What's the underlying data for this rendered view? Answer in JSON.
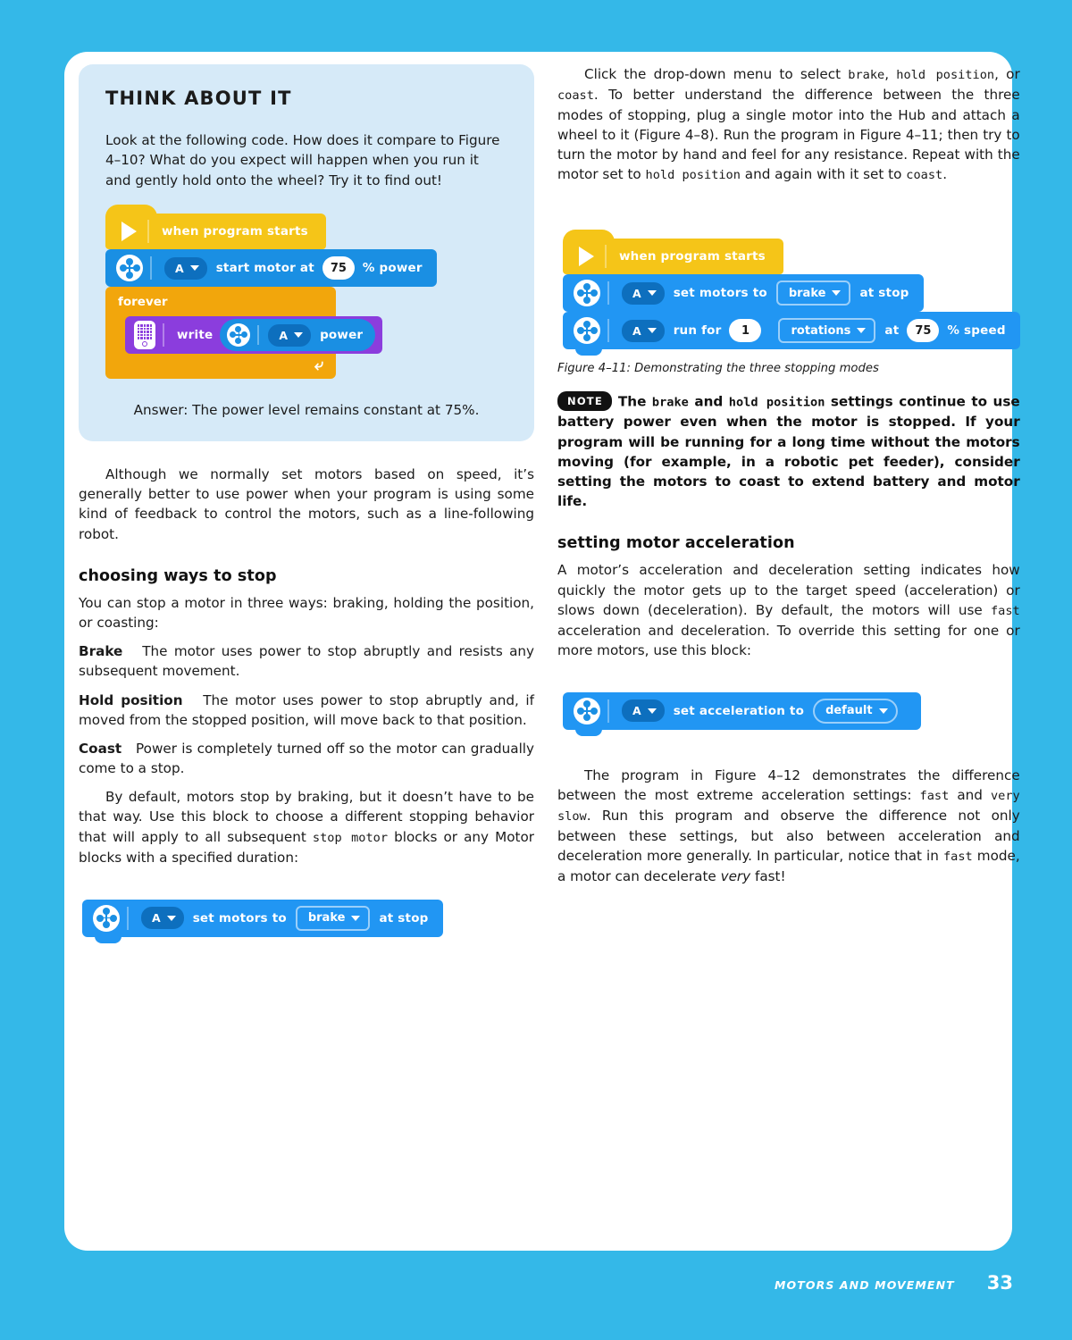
{
  "page": {
    "background_color": "#34b8e8",
    "card_color": "#ffffff",
    "running_head": "MOTORS AND MOVEMENT",
    "page_number": "33"
  },
  "think_about_it": {
    "title": "THINK ABOUT IT",
    "intro": "Look at the following code. How does it compare to Figure 4–10? What do you expect will happen when you run it and gently hold onto the wheel? Try it to find out!",
    "answer": "Answer: The power level remains constant at 75%.",
    "box_color": "#d6eaf8",
    "program": {
      "hat_label": "when program starts",
      "start_motor": {
        "port": "A",
        "label": "start motor at",
        "value": "75",
        "suffix": "% power"
      },
      "forever_label": "forever",
      "write_block": {
        "label": "write",
        "port": "A",
        "suffix": "power"
      }
    }
  },
  "left_column": {
    "para_power": "Although we normally set motors based on speed, it’s generally better to use power when your program is using some kind of feedback to control the motors, such as a line-following robot.",
    "heading_stop": "choosing ways to stop",
    "para_three_ways": "You can stop a motor in three ways: braking, holding the position, or coasting:",
    "terms": [
      {
        "term": "Brake",
        "definition": "The motor uses power to stop abruptly and resists any subsequent movement."
      },
      {
        "term": "Hold position",
        "definition": "The motor uses power to stop abruptly and, if moved from the stopped position, will move back to that position."
      },
      {
        "term": "Coast",
        "definition": "Power is completely turned off so the motor can gradually come to a stop."
      }
    ],
    "para_default_braking_1": "By default, motors stop by braking, but it doesn’t have to be that way. Use this block to choose a different stopping behavior that will apply to all subsequent ",
    "para_default_braking_code": "stop motor",
    "para_default_braking_2": " blocks or any Motor blocks with a specified duration:",
    "set_motors_block": {
      "port": "A",
      "label": "set motors to",
      "option": "brake",
      "suffix": "at stop"
    }
  },
  "right_column": {
    "para_dropdown_1": "Click the drop-down menu to select ",
    "para_dropdown_code1": "brake",
    "para_dropdown_2": ", ",
    "para_dropdown_code2": "hold position",
    "para_dropdown_3": ", or ",
    "para_dropdown_code3": "coast",
    "para_dropdown_4": ". To better understand the difference between the three modes of stopping, plug a single motor into the Hub and attach a wheel to it (Figure 4–8). Run the program in Figure 4–11; then try to turn the motor by hand and feel for any resistance. Repeat with the motor set to ",
    "para_dropdown_code4": "hold position",
    "para_dropdown_5": " and again with it set to ",
    "para_dropdown_code5": "coast",
    "para_dropdown_6": ".",
    "figure_program": {
      "hat_label": "when program starts",
      "set_motors": {
        "port": "A",
        "label": "set motors to",
        "option": "brake",
        "suffix": "at stop"
      },
      "run_for": {
        "port": "A",
        "label": "run for",
        "value": "1",
        "unit": "rotations",
        "at": "at",
        "speed": "75",
        "suffix": "% speed"
      }
    },
    "figure_caption": "Figure 4–11: Demonstrating the three stopping modes",
    "note": {
      "badge": "NOTE",
      "text_1": "The ",
      "code_1": "brake",
      "text_2": " and ",
      "code_2": "hold position",
      "text_3": " settings continue to use battery power even when the motor is stopped. If your program will be running for a long time without the motors moving (for example, in a robotic pet feeder), consider setting the motors to coast to extend battery and motor life."
    },
    "heading_acceleration": "setting motor acceleration",
    "para_accel_1": "A motor’s acceleration and deceleration setting indicates how quickly the motor gets up to the target speed (acceleration) or slows down (deceleration). By default, the motors will use ",
    "para_accel_code": "fast",
    "para_accel_2": " acceleration and deceleration. To override this setting for one or more motors, use this block:",
    "set_acceleration_block": {
      "port": "A",
      "label": "set acceleration to",
      "option": "default"
    },
    "para_figure412_1": "The program in Figure 4–12 demonstrates the difference between the most extreme acceleration settings: ",
    "para_figure412_code1": "fast",
    "para_figure412_2": " and ",
    "para_figure412_code2": "very slow",
    "para_figure412_3": ". Run this program and observe the difference not only between these settings, but also between acceleration and deceleration more generally. In particular, notice that in ",
    "para_figure412_code3": "fast",
    "para_figure412_4": " mode, a motor can decelerate ",
    "para_figure412_ital": "very",
    "para_figure412_5": " fast!"
  }
}
